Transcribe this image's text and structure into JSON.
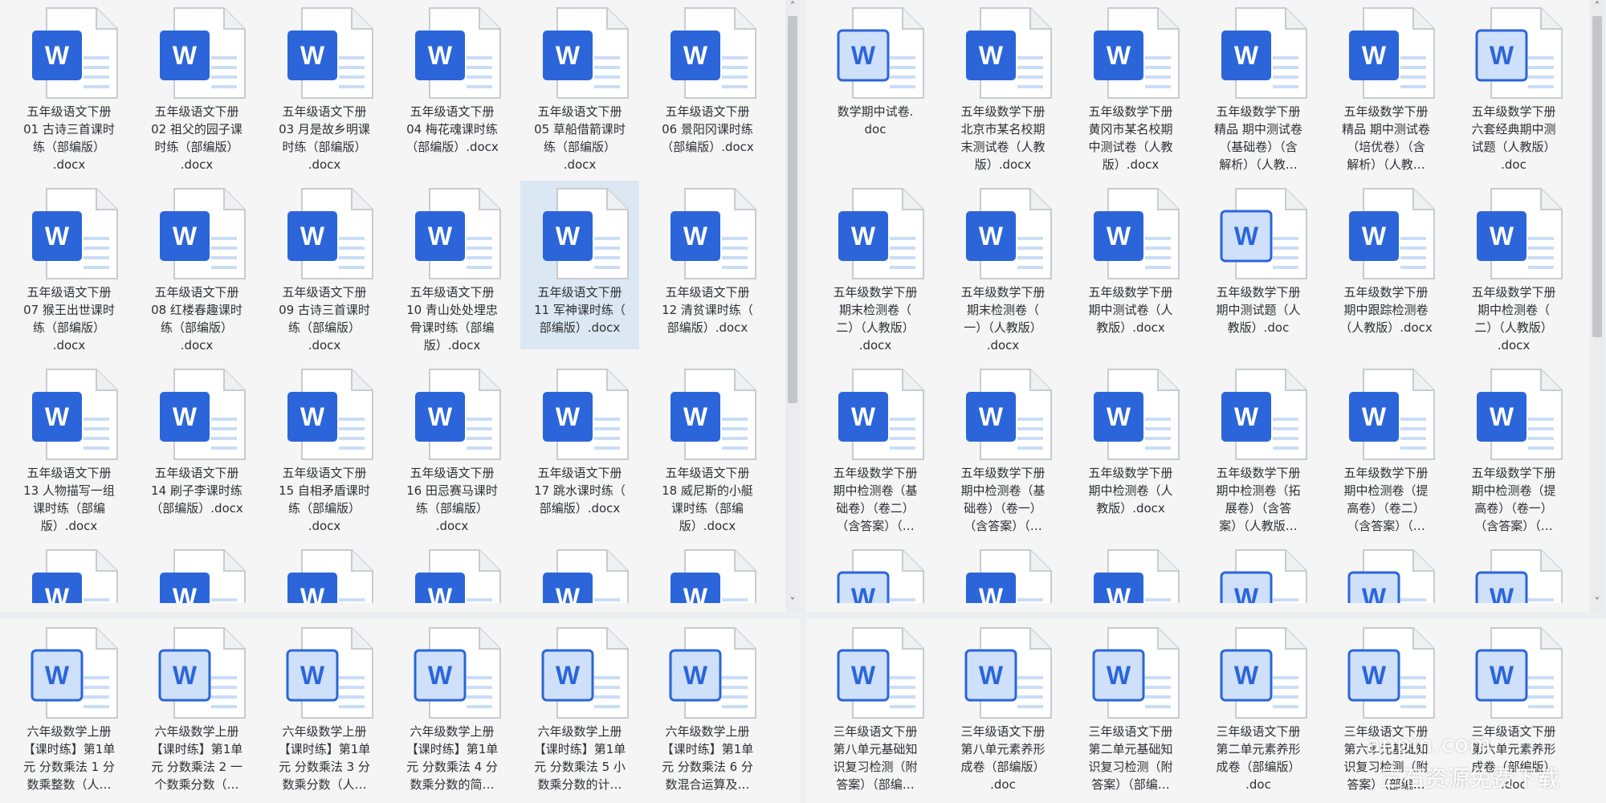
{
  "left_panel": {
    "files": [
      {
        "label": "五年级语文下册\n01 古诗三首课时\n练（部编版）\n.docx",
        "style": "solid"
      },
      {
        "label": "五年级语文下册\n02 祖父的园子课\n时练（部编版）\n.docx",
        "style": "solid"
      },
      {
        "label": "五年级语文下册\n03 月是故乡明课\n时练（部编版）\n.docx",
        "style": "solid"
      },
      {
        "label": "五年级语文下册\n04 梅花魂课时练\n（部编版）.docx",
        "style": "solid"
      },
      {
        "label": "五年级语文下册\n05 草船借箭课时\n练（部编版）\n.docx",
        "style": "solid"
      },
      {
        "label": "五年级语文下册\n06 景阳冈课时练\n（部编版）.docx",
        "style": "solid"
      },
      {
        "label": "五年级语文下册\n07 猴王出世课时\n练（部编版）\n.docx",
        "style": "solid"
      },
      {
        "label": "五年级语文下册\n08 红楼春趣课时\n练（部编版）\n.docx",
        "style": "solid"
      },
      {
        "label": "五年级语文下册\n09 古诗三首课时\n练（部编版）\n.docx",
        "style": "solid"
      },
      {
        "label": "五年级语文下册\n10 青山处处埋忠\n骨课时练（部编\n版）.docx",
        "style": "solid"
      },
      {
        "label": "五年级语文下册\n11 军神课时练（\n部编版）.docx",
        "style": "solid",
        "selected": true
      },
      {
        "label": "五年级语文下册\n12 清贫课时练（\n部编版）.docx",
        "style": "solid"
      },
      {
        "label": "五年级语文下册\n13 人物描写一组\n课时练（部编\n版）.docx",
        "style": "solid"
      },
      {
        "label": "五年级语文下册\n14 刷子李课时练\n（部编版）.docx",
        "style": "solid"
      },
      {
        "label": "五年级语文下册\n15 自相矛盾课时\n练（部编版）\n.docx",
        "style": "solid"
      },
      {
        "label": "五年级语文下册\n16 田忌赛马课时\n练（部编版）\n.docx",
        "style": "solid"
      },
      {
        "label": "五年级语文下册\n17 跳水课时练（\n部编版）.docx",
        "style": "solid"
      },
      {
        "label": "五年级语文下册\n18 威尼斯的小艇\n课时练（部编\n版）.docx",
        "style": "solid"
      }
    ],
    "partial_row_styles": [
      "solid",
      "solid",
      "solid",
      "solid",
      "solid",
      "solid"
    ]
  },
  "left_bottom": {
    "files": [
      {
        "label": "六年级数学上册\n【课时练】第1单\n元 分数乘法 1 分\n数乘整数（人…",
        "style": "light"
      },
      {
        "label": "六年级数学上册\n【课时练】第1单\n元 分数乘法 2 一\n个数乘分数（…",
        "style": "light"
      },
      {
        "label": "六年级数学上册\n【课时练】第1单\n元 分数乘法 3 分\n数乘分数（人…",
        "style": "light"
      },
      {
        "label": "六年级数学上册\n【课时练】第1单\n元 分数乘法 4 分\n数乘分数的简…",
        "style": "light"
      },
      {
        "label": "六年级数学上册\n【课时练】第1单\n元 分数乘法 5 小\n数乘分数的计…",
        "style": "light"
      },
      {
        "label": "六年级数学上册\n【课时练】第1单\n元 分数乘法 6 分\n数混合运算及…",
        "style": "light"
      }
    ]
  },
  "right_panel": {
    "files": [
      {
        "label": "数学期中试卷.\ndoc",
        "style": "light"
      },
      {
        "label": "五年级数学下册\n北京市某名校期\n末测试卷（人教\n版）.docx",
        "style": "solid"
      },
      {
        "label": "五年级数学下册\n黄冈市某名校期\n中测试卷（人教\n版）.docx",
        "style": "solid"
      },
      {
        "label": "五年级数学下册\n精品 期中测试卷\n（基础卷）（含\n解析）（人教…",
        "style": "solid"
      },
      {
        "label": "五年级数学下册\n精品 期中测试卷\n（培优卷）（含\n解析）（人教…",
        "style": "solid"
      },
      {
        "label": "五年级数学下册\n六套经典期中测\n试题（人教版）\n.doc",
        "style": "light"
      },
      {
        "label": "五年级数学下册\n期末检测卷（\n二）（人教版）\n.docx",
        "style": "solid"
      },
      {
        "label": "五年级数学下册\n期末检测卷（\n一）（人教版）\n.docx",
        "style": "solid"
      },
      {
        "label": "五年级数学下册\n期中测试卷（人\n教版）.docx",
        "style": "solid"
      },
      {
        "label": "五年级数学下册\n期中测试题（人\n教版）.doc",
        "style": "light"
      },
      {
        "label": "五年级数学下册\n期中跟踪检测卷\n（人教版）.docx",
        "style": "solid"
      },
      {
        "label": "五年级数学下册\n期中检测卷（\n二）（人教版）\n.docx",
        "style": "solid"
      },
      {
        "label": "五年级数学下册\n期中检测卷（基\n础卷）（卷二）\n（含答案）（…",
        "style": "solid"
      },
      {
        "label": "五年级数学下册\n期中检测卷（基\n础卷）（卷一）\n（含答案）（…",
        "style": "solid"
      },
      {
        "label": "五年级数学下册\n期中检测卷（人\n教版）.docx",
        "style": "solid"
      },
      {
        "label": "五年级数学下册\n期中检测卷（拓\n展卷）（含答\n案）（人教版…",
        "style": "solid"
      },
      {
        "label": "五年级数学下册\n期中检测卷（提\n高卷）（卷二）\n（含答案）（…",
        "style": "solid"
      },
      {
        "label": "五年级数学下册\n期中检测卷（提\n高卷）（卷一）\n（含答案）（…",
        "style": "solid"
      }
    ],
    "partial_row_styles": [
      "light",
      "solid",
      "solid",
      "light",
      "light",
      "light"
    ]
  },
  "right_bottom": {
    "files": [
      {
        "label": "三年级语文下册\n第八单元基础知\n识复习检测（附\n答案）（部编…",
        "style": "light"
      },
      {
        "label": "三年级语文下册\n第八单元素养形\n成卷（部编版）\n.doc",
        "style": "light"
      },
      {
        "label": "三年级语文下册\n第二单元基础知\n识复习检测（附\n答案）（部编…",
        "style": "light"
      },
      {
        "label": "三年级语文下册\n第二单元素养形\n成卷（部编版）\n.doc",
        "style": "light"
      },
      {
        "label": "三年级语文下册\n第六单元基础知\n识复习检测（附\n答案）（部编…",
        "style": "light"
      },
      {
        "label": "三年级语文下册\n第六单元素养形\n成卷（部编版）\n.doc",
        "style": "light"
      }
    ]
  },
  "watermark": {
    "line1": "anpin.com",
    "line2": "三石资源免费下载"
  },
  "icon_letter": "W",
  "colors": {
    "word_blue": "#2b65d9",
    "word_blue_light": "#cfe0fb",
    "selection": "#dbe7f3"
  }
}
